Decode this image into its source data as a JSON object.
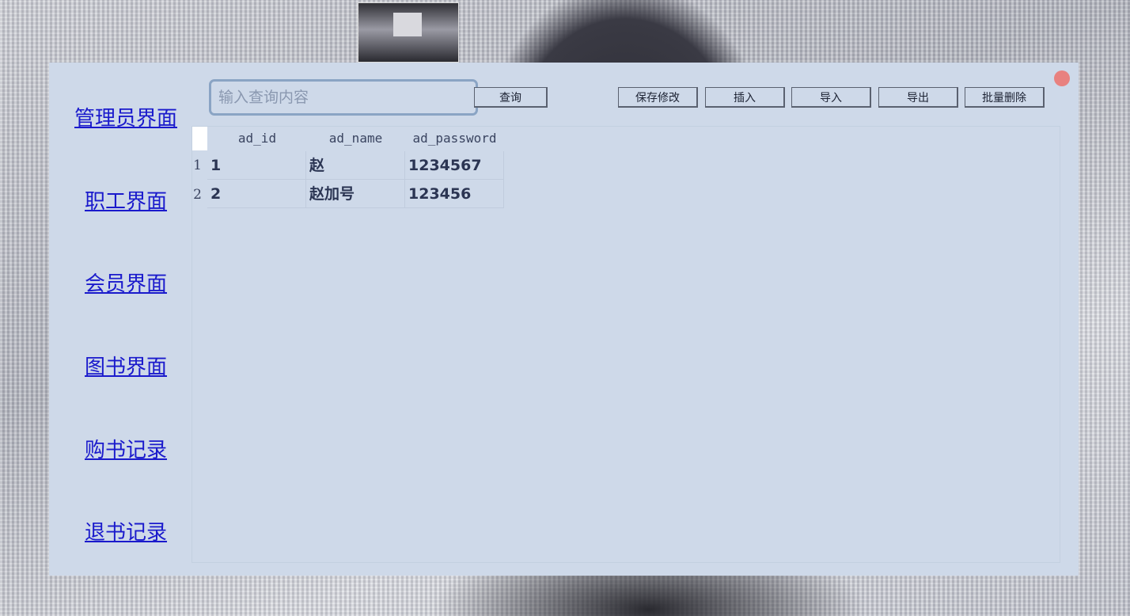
{
  "sidebar": {
    "items": [
      {
        "label": "管理员界面"
      },
      {
        "label": "职工界面"
      },
      {
        "label": "会员界面"
      },
      {
        "label": "图书界面"
      },
      {
        "label": "购书记录"
      },
      {
        "label": "退书记录"
      }
    ]
  },
  "toolbar": {
    "search_placeholder": "输入查询内容",
    "search_value": "",
    "query_label": "查询",
    "save_label": "保存修改",
    "insert_label": "插入",
    "import_label": "导入",
    "export_label": "导出",
    "batch_delete_label": "批量删除"
  },
  "table": {
    "columns": [
      "ad_id",
      "ad_name",
      "ad_password"
    ],
    "rows": [
      {
        "num": "1",
        "cells": [
          "1",
          "赵",
          "1234567"
        ]
      },
      {
        "num": "2",
        "cells": [
          "2",
          "赵加号",
          "123456"
        ]
      }
    ]
  },
  "colors": {
    "window_bg": "#ced9e9",
    "link": "#1a1acc",
    "close_button": "#e8817f"
  },
  "icons": {
    "close": "close-dot-icon"
  }
}
